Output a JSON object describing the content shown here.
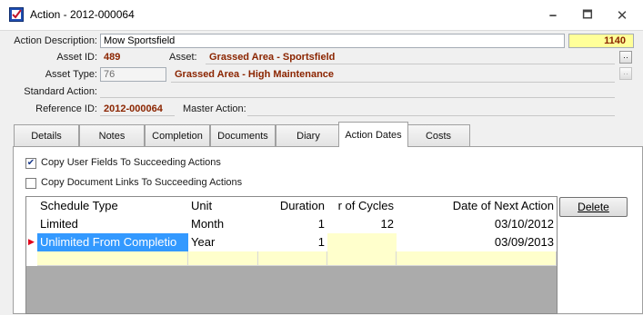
{
  "window": {
    "title": "Action - 2012-000064",
    "minimize": "🗕",
    "maximize": "🗖",
    "close": "✕"
  },
  "form": {
    "action_description_label": "Action Description:",
    "action_description_value": "Mow Sportsfield",
    "code_value": "1140",
    "asset_id_label": "Asset ID:",
    "asset_id_value": "489",
    "asset_label": "Asset:",
    "asset_value": "Grassed Area - Sportsfield",
    "asset_type_label": "Asset Type:",
    "asset_type_code": "76",
    "asset_type_value": "Grassed Area - High Maintenance",
    "standard_action_label": "Standard Action:",
    "reference_id_label": "Reference ID:",
    "reference_id_value": "2012-000064",
    "master_action_label": "Master Action:",
    "lookup_button": "‥"
  },
  "tabs": [
    {
      "label": "Details"
    },
    {
      "label": "Notes"
    },
    {
      "label": "Completion"
    },
    {
      "label": "Documents"
    },
    {
      "label": "Diary"
    },
    {
      "label": "Action Dates"
    },
    {
      "label": "Costs"
    }
  ],
  "active_tab": "Action Dates",
  "options": {
    "copy_user_fields_label": "Copy User Fields To Succeeding Actions",
    "copy_user_fields_checked": true,
    "copy_doc_links_label": "Copy Document Links To Succeeding Actions",
    "copy_doc_links_checked": false
  },
  "grid": {
    "columns": [
      "Schedule Type",
      "Unit",
      "Duration",
      "r of Cycles",
      "Date of Next Action"
    ],
    "rows": [
      {
        "schedule_type": "Limited",
        "unit": "Month",
        "duration": "1",
        "cycles": "12",
        "next_date": "03/10/2012"
      },
      {
        "schedule_type": "Unlimited From Completio",
        "unit": "Year",
        "duration": "1",
        "cycles": "",
        "next_date": "03/09/2013"
      }
    ],
    "current_row_indicator": "▶"
  },
  "buttons": {
    "delete": "Delete"
  },
  "colors": {
    "accent_value": "#8b2500",
    "selection": "#3399ff",
    "new_row": "#ffffcc",
    "code_box": "#ffff99"
  }
}
